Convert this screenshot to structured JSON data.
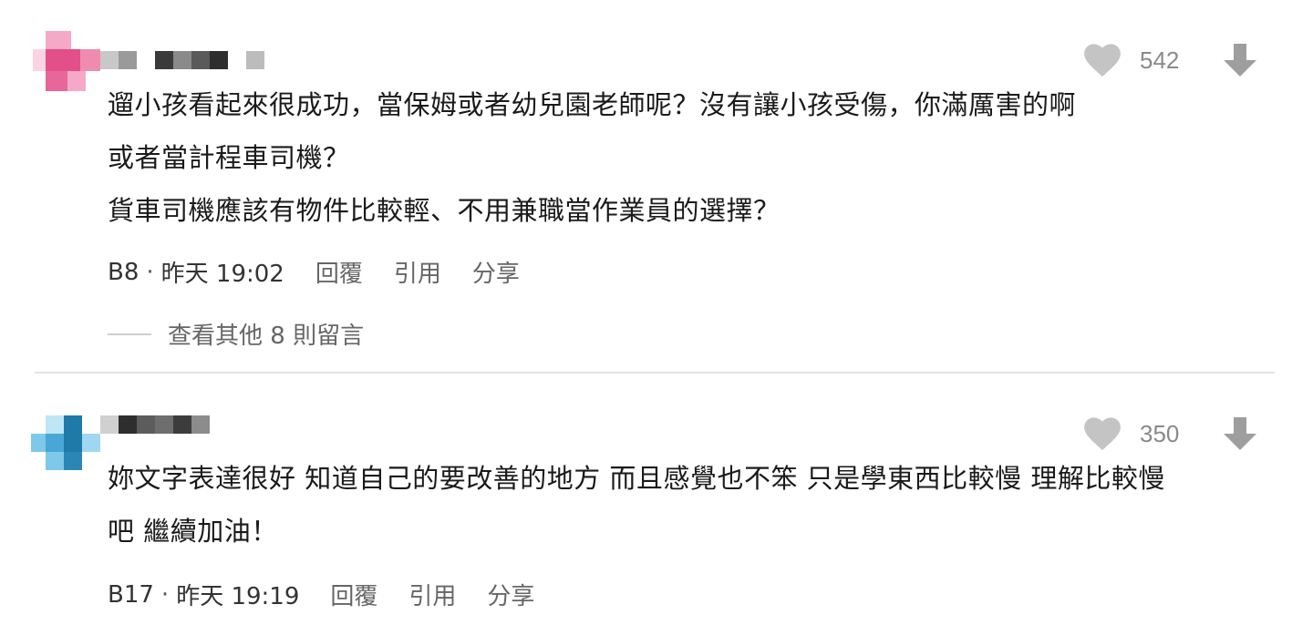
{
  "colors": {
    "heart": "#c4c4c4",
    "arrow": "#9e9e9e",
    "avatar1_pink": "#f08bb0",
    "avatar1_dark": "#e24f8a",
    "avatar2_light": "#7ec8ea",
    "avatar2_dark": "#1f7aa8"
  },
  "comments": [
    {
      "avatar_icon": "pixelated-avatar-pink",
      "author_name": "",
      "likes": "542",
      "lines": [
        "遛小孩看起來很成功，當保姆或者幼兒園老師呢？沒有讓小孩受傷，你滿厲害的啊",
        "或者當計程車司機？",
        "貨車司機應該有物件比較輕、不用兼職當作業員的選擇？"
      ],
      "floor": "B8",
      "dot": "·",
      "time": "昨天 19:02",
      "reply_label": "回覆",
      "quote_label": "引用",
      "share_label": "分享",
      "more_replies_label": "查看其他 8 則留言"
    },
    {
      "avatar_icon": "pixelated-avatar-blue",
      "author_name": "",
      "likes": "350",
      "lines": [
        "妳文字表達很好 知道自己的要改善的地方 而且感覺也不笨 只是學東西比較慢 理解比較慢",
        "吧 繼續加油！"
      ],
      "floor": "B17",
      "dot": "·",
      "time": "昨天 19:19",
      "reply_label": "回覆",
      "quote_label": "引用",
      "share_label": "分享"
    }
  ]
}
